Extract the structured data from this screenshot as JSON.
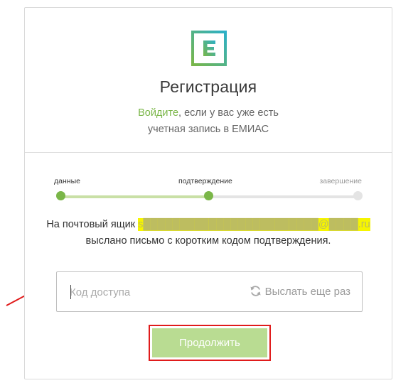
{
  "brand": {
    "logo_icon": "emias-logo-icon",
    "colors": {
      "green": "#7ab648",
      "teal": "#2cb0c8"
    }
  },
  "title": "Регистрация",
  "subtitle": {
    "login_link": "Войдите",
    "text_after_link": ", если у вас уже есть",
    "line2": "учетная запись в ЕМИАС"
  },
  "steps": {
    "items": [
      {
        "label": "данные",
        "state": "done"
      },
      {
        "label": "подтверждение",
        "state": "current"
      },
      {
        "label": "завершение",
        "state": "pending"
      }
    ],
    "progress": 0.5
  },
  "message": {
    "line1_prefix": "На почтовый ящик",
    "email_masked": "s████████████████████████@████.ru",
    "line2": "выслано письмо с коротким кодом подтверждения."
  },
  "code_field": {
    "placeholder": "Код доступа",
    "value": "",
    "resend_label": "Выслать еще раз",
    "resend_icon": "refresh-icon"
  },
  "continue_button": {
    "label": "Продолжить"
  },
  "annotation": {
    "arrow_icon": "red-arrow-icon",
    "highlight_color": "#e01b1b"
  }
}
